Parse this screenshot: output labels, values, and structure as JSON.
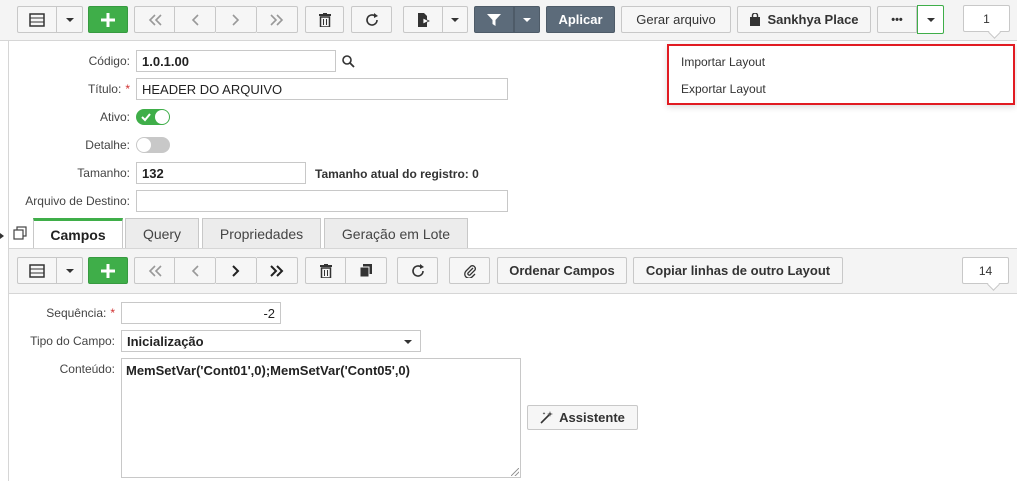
{
  "toolbar": {
    "apply_label": "Aplicar",
    "generate_label": "Gerar arquivo",
    "place_label": "Sankhya Place",
    "more_label": "•••",
    "page_number": "1"
  },
  "menu": {
    "items": [
      {
        "label": "Importar Layout"
      },
      {
        "label": "Exportar Layout"
      }
    ]
  },
  "form": {
    "codigo_label": "Código:",
    "codigo_value": "1.0.1.00",
    "titulo_label": "Título:",
    "titulo_value": "HEADER DO ARQUIVO",
    "ativo_label": "Ativo:",
    "detalhe_label": "Detalhe:",
    "tamanho_label": "Tamanho:",
    "tamanho_value": "132",
    "tamanho_atual_label": "Tamanho atual do registro: 0",
    "destino_label": "Arquivo de Destino:",
    "destino_value": ""
  },
  "tabs": [
    {
      "label": "Campos"
    },
    {
      "label": "Query"
    },
    {
      "label": "Propriedades"
    },
    {
      "label": "Geração em Lote"
    }
  ],
  "subtoolbar": {
    "order_label": "Ordenar Campos",
    "copy_label": "Copiar linhas de outro Layout",
    "page_number": "14"
  },
  "detail": {
    "sequencia_label": "Sequência:",
    "sequencia_value": "-2",
    "tipo_label": "Tipo do Campo:",
    "tipo_value": "Inicialização",
    "conteudo_label": "Conteúdo:",
    "conteudo_value": "MemSetVar('Cont01',0);MemSetVar('Cont05',0)",
    "assistant_label": "Assistente"
  },
  "colors": {
    "green": "#3fae49",
    "dark": "#5c6b7a",
    "red_highlight": "#e11b22"
  }
}
